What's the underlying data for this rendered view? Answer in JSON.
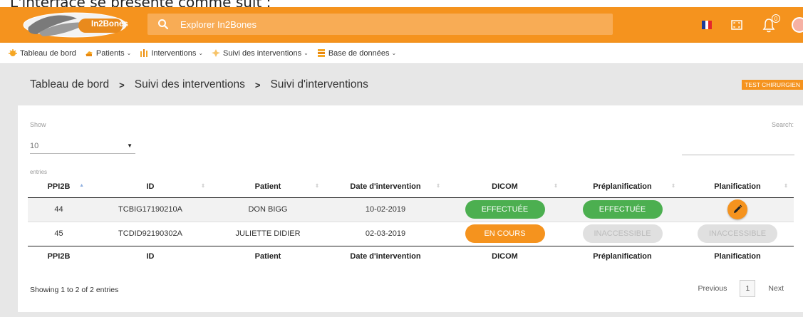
{
  "caption": "L'interface se présente comme suit :",
  "header": {
    "logo_text": "In2Bones",
    "search_placeholder": "Explorer In2Bones",
    "notification_count": "0",
    "colors": {
      "brand": "#f5931e"
    }
  },
  "nav": {
    "items": [
      {
        "label": "Tableau de bord",
        "icon": "dashboard-icon",
        "has_dropdown": false
      },
      {
        "label": "Patients",
        "icon": "patients-icon",
        "has_dropdown": true
      },
      {
        "label": "Interventions",
        "icon": "interventions-icon",
        "has_dropdown": true
      },
      {
        "label": "Suivi des interventions",
        "icon": "tracking-icon",
        "has_dropdown": true
      },
      {
        "label": "Base de données",
        "icon": "database-icon",
        "has_dropdown": true
      }
    ]
  },
  "breadcrumb": {
    "items": [
      "Tableau de bord",
      "Suivi des interventions",
      "Suivi d'interventions"
    ]
  },
  "role_badge": "TEST CHIRURGIEN",
  "table_controls": {
    "show_label": "Show",
    "show_value": "10",
    "entries_label": "entries",
    "search_label": "Search:"
  },
  "table": {
    "columns": [
      "PPI2B",
      "ID",
      "Patient",
      "Date d'intervention",
      "DICOM",
      "Préplanification",
      "Planification"
    ],
    "rows": [
      {
        "ppi2b": "44",
        "id": "TCBIG17190210A",
        "patient": "DON BIGG",
        "date": "10-02-2019",
        "dicom": "EFFECTUÉE",
        "preplanification": "EFFECTUÉE",
        "planification": "edit"
      },
      {
        "ppi2b": "45",
        "id": "TCDID92190302A",
        "patient": "JULIETTE DIDIER",
        "date": "02-03-2019",
        "dicom": "EN COURS",
        "preplanification": "INACCESSIBLE",
        "planification": "INACCESSIBLE"
      }
    ]
  },
  "footer": {
    "showing_text": "Showing 1 to 2 of 2 entries",
    "previous": "Previous",
    "current_page": "1",
    "next": "Next"
  }
}
